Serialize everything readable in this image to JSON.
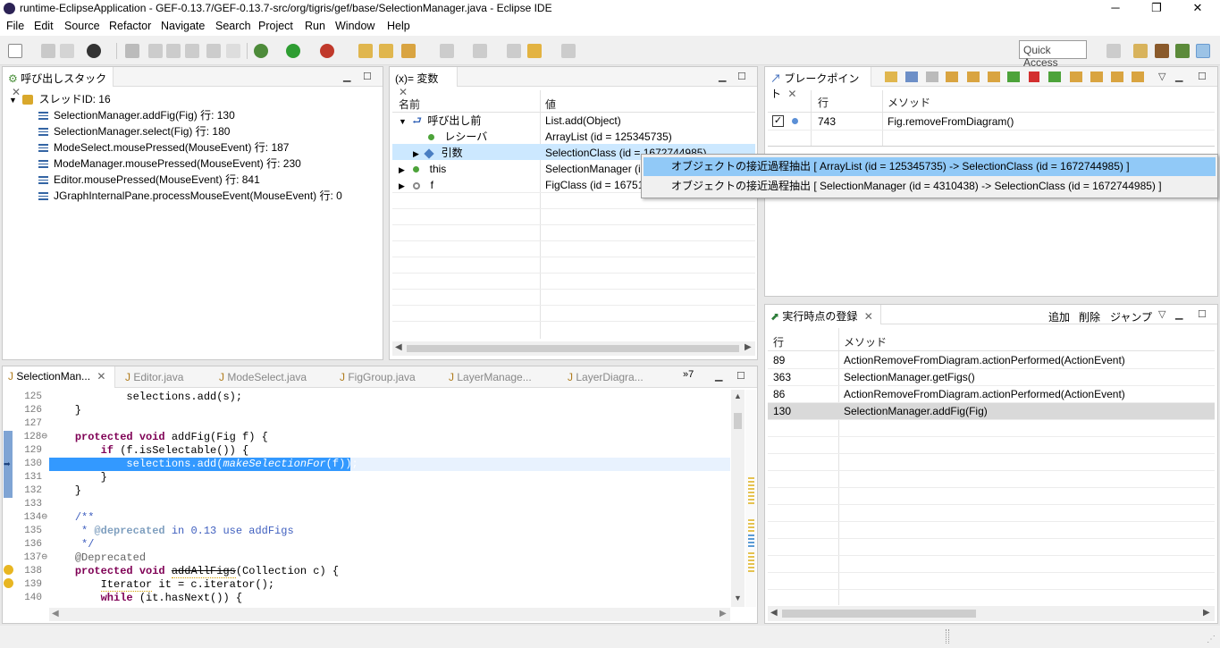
{
  "window": {
    "title": "runtime-EclipseApplication - GEF-0.13.7/GEF-0.13.7-src/org/tigris/gef/base/SelectionManager.java - Eclipse IDE",
    "minimize": "─",
    "maximize": "❐",
    "close": "✕"
  },
  "menu": [
    "File",
    "Edit",
    "Source",
    "Refactor",
    "Navigate",
    "Search",
    "Project",
    "Run",
    "Window",
    "Help"
  ],
  "toolbar": {
    "quick_access": "Quick Access"
  },
  "callstack": {
    "tab_label": "呼び出しスタック",
    "thread": "スレッドID: 16",
    "frames": [
      "SelectionManager.addFig(Fig) 行: 130",
      "SelectionManager.select(Fig) 行: 180",
      "ModeSelect.mousePressed(MouseEvent) 行: 187",
      "ModeManager.mousePressed(MouseEvent) 行: 230",
      "Editor.mousePressed(MouseEvent) 行: 841",
      "JGraphInternalPane.processMouseEvent(MouseEvent) 行: 0"
    ]
  },
  "variables": {
    "tab_label": "(x)= 変数",
    "col_name": "名前",
    "col_value": "値",
    "rows": [
      {
        "name": "呼び出し前",
        "value": "List.add(Object)"
      },
      {
        "name": "レシーバ",
        "value": "ArrayList (id = 125345735)"
      },
      {
        "name": "引数",
        "value": "SelectionClass (id = 1672744985)"
      },
      {
        "name": "this",
        "value": "SelectionManager (id"
      },
      {
        "name": "f",
        "value": "FigClass (id = 167517"
      }
    ]
  },
  "breakpoints": {
    "tab_label": "ブレークポイント",
    "col_line": "行",
    "col_method": "メソッド",
    "rows": [
      {
        "line": "743",
        "method": "Fig.removeFromDiagram()"
      }
    ]
  },
  "popup": {
    "items": [
      "オブジェクトの接近過程抽出 [ ArrayList (id = 125345735) -> SelectionClass (id = 1672744985) ]",
      "オブジェクトの接近過程抽出 [ SelectionManager (id = 4310438) -> SelectionClass (id = 1672744985) ]"
    ]
  },
  "runtime": {
    "tab_label": "実行時点の登録",
    "add": "追加",
    "delete": "削除",
    "jump": "ジャンプ",
    "col_line": "行",
    "col_method": "メソッド",
    "rows": [
      {
        "line": "89",
        "method": "ActionRemoveFromDiagram.actionPerformed(ActionEvent)"
      },
      {
        "line": "363",
        "method": "SelectionManager.getFigs()"
      },
      {
        "line": "86",
        "method": "ActionRemoveFromDiagram.actionPerformed(ActionEvent)"
      },
      {
        "line": "130",
        "method": "SelectionManager.addFig(Fig)"
      }
    ]
  },
  "editor": {
    "tabs": [
      "SelectionMan...",
      "Editor.java",
      "ModeSelect.java",
      "FigGroup.java",
      "LayerManage...",
      "LayerDiagra..."
    ],
    "overflow": "»7",
    "line_numbers": [
      "125",
      "126",
      "127",
      "128⊖",
      "129",
      "130",
      "131",
      "132",
      "133",
      "134⊖",
      "135",
      "136",
      "137⊖",
      "138",
      "139",
      "140"
    ],
    "code": {
      "l125": "        selections.add(s);",
      "l126": "    }",
      "l128_kw": "protected void",
      "l128_rest": " addFig(Fig f) {",
      "l129_kw": "if",
      "l129_rest": " (f.isSelectable()) {",
      "l130_a": "selections.add(",
      "l130_b": "makeSelectionFor",
      "l130_c": "(f));",
      "l131": "        }",
      "l132": "    }",
      "l134": "/**",
      "l135_a": " * ",
      "l135_b": "@deprecated",
      "l135_c": " in 0.13 use addFigs",
      "l136": " */",
      "l137": "@Deprecated",
      "l138_kw": "protected void",
      "l138_name": "addAllFigs",
      "l138_rest": "(Collection c) {",
      "l139_a": "Iterator",
      "l139_b": " it = c.iterator();",
      "l140_kw": "while",
      "l140_rest": " (it.hasNext()) {"
    }
  }
}
